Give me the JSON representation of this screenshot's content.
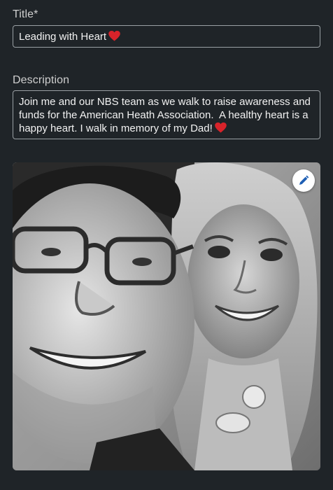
{
  "title_field": {
    "label": "Title*",
    "value": "Leading with Heart",
    "emoji": "heart-emoji"
  },
  "description_field": {
    "label": "Description",
    "value": "Join me and our NBS team as we walk to raise awareness and funds for the American Heath Association.  A healthy heart is a happy heart. I walk in memory of my Dad!",
    "emoji": "heart-emoji"
  },
  "photo": {
    "alt": "photo",
    "edit_icon": "pencil-icon"
  },
  "colors": {
    "background": "#1f2428",
    "field_border": "#9aa0a4",
    "heart": "#d8232a",
    "edit_icon": "#1e5fb4"
  }
}
